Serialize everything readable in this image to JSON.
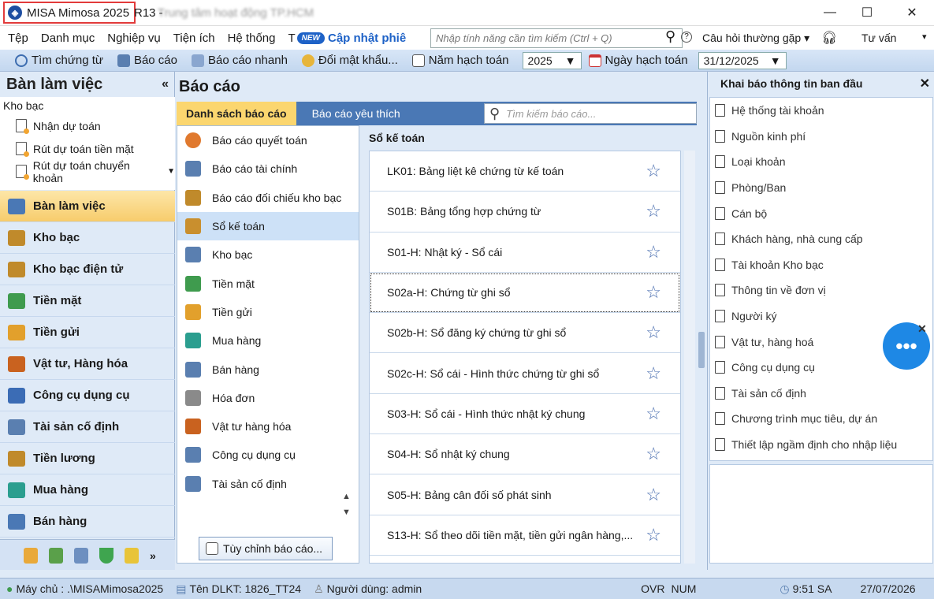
{
  "window": {
    "app_name": "MISA Mimosa 2025",
    "version": "R13 -",
    "title_blurred": "Trung tâm hoạt động TP.HCM",
    "minimize": "—",
    "maximize": "☐",
    "close": "✕"
  },
  "menu": {
    "items": [
      "Tệp",
      "Danh mục",
      "Nghiệp vụ",
      "Tiện ích",
      "Hệ thống",
      "T"
    ],
    "new_badge": "NEW",
    "update_label": "Cập nhật phiê",
    "search_placeholder": "Nhập tính năng cần tìm kiếm (Ctrl + Q)",
    "faq": "Câu hỏi thường gặp",
    "consult": "Tư vấn"
  },
  "toolbar": {
    "find_voucher": "Tìm chứng từ",
    "report": "Báo cáo",
    "quick_report": "Báo cáo nhanh",
    "change_password": "Đổi mật khẩu...",
    "fiscal_year_label": "Năm hạch toán",
    "fiscal_year_value": "2025",
    "posting_date_label": "Ngày hạch toán",
    "posting_date_value": "31/12/2025"
  },
  "left": {
    "title": "Bàn làm việc",
    "collapse": "«",
    "section": "Kho bạc",
    "sub_items": [
      "Nhận dự toán",
      "Rút dự toán tiền mặt",
      "Rút dự toán chuyển khoản"
    ],
    "modules": [
      "Bàn làm việc",
      "Kho bạc",
      "Kho bạc điện tử",
      "Tiền mặt",
      "Tiền gửi",
      "Vật tư, Hàng hóa",
      "Công cụ dụng cụ",
      "Tài sản cố định",
      "Tiền lương",
      "Mua hàng",
      "Bán hàng"
    ],
    "module_colors": [
      "#4a78b5",
      "#c08a2b",
      "#c08a2b",
      "#3f9b4e",
      "#e2a02c",
      "#c9621f",
      "#3b6cb5",
      "#5a7fb0",
      "#c08a2b",
      "#2b9e8f",
      "#4a78b5"
    ],
    "bottom_icon_colors": [
      "#e9a93a",
      "#5aa04a",
      "#6d8fc0",
      "#3fa54f",
      "#e8c43a"
    ],
    "more": "»"
  },
  "center": {
    "title": "Báo cáo",
    "tabs": [
      "Danh sách báo cáo",
      "Báo cáo yêu thích"
    ],
    "search_placeholder": "Tìm kiếm báo cáo...",
    "categories": [
      "Báo cáo quyết toán",
      "Báo cáo tài chính",
      "Báo cáo đối chiếu kho bạc",
      "Sổ kế toán",
      "Kho bạc",
      "Tiền mặt",
      "Tiền gửi",
      "Mua hàng",
      "Bán hàng",
      "Hóa đơn",
      "Vật tư hàng hóa",
      "Công cụ dụng cụ",
      "Tài sản cố định"
    ],
    "category_colors": [
      "#e0792e",
      "#5a7fb0",
      "#c08a2b",
      "#c98f2e",
      "#5a7fb0",
      "#3f9b4e",
      "#e2a02c",
      "#2b9e8f",
      "#5a7fb0",
      "#8a8a8a",
      "#c9621f",
      "#5a7fb0",
      "#5a7fb0"
    ],
    "customize_button": "Tùy chỉnh báo cáo...",
    "report_heading": "Sổ kế toán",
    "reports": [
      "LK01: Bảng liệt kê chứng từ kế toán",
      "S01B: Bảng tổng hợp chứng từ",
      "S01-H: Nhật ký - Sổ cái",
      "S02a-H: Chứng từ ghi sổ",
      "S02b-H: Sổ đăng ký chứng từ ghi sổ",
      "S02c-H: Sổ cái - Hình thức chứng từ ghi sổ",
      "S03-H: Sổ cái - Hình thức nhật ký chung",
      "S04-H: Sổ nhật ký chung",
      "S05-H: Bảng cân đối số phát sinh",
      "S13-H: Sổ theo dõi tiền mặt, tiền gửi ngân hàng,..."
    ],
    "star": "☆"
  },
  "right": {
    "title": "Khai báo thông tin ban đầu",
    "close": "✕",
    "items": [
      "Hệ thống tài khoản",
      "Nguồn kinh phí",
      "Loại khoản",
      "Phòng/Ban",
      "Cán bộ",
      "Khách hàng, nhà cung cấp",
      "Tài khoản Kho bạc",
      "Thông tin về đơn vị",
      "Người ký",
      "Vật tư, hàng hoá",
      "Công cụ dụng cụ",
      "Tài sản cố định",
      "Chương trình mục tiêu, dự án",
      "Thiết lập ngầm định cho nhập liệu"
    ]
  },
  "status": {
    "server": "Máy chủ : .\\MISAMimosa2025",
    "db": "Tên DLKT: 1826_TT24",
    "user": "Người dùng: admin",
    "ovr": "OVR",
    "num": "NUM",
    "time": "9:51 SA",
    "date": "27/07/2026"
  }
}
